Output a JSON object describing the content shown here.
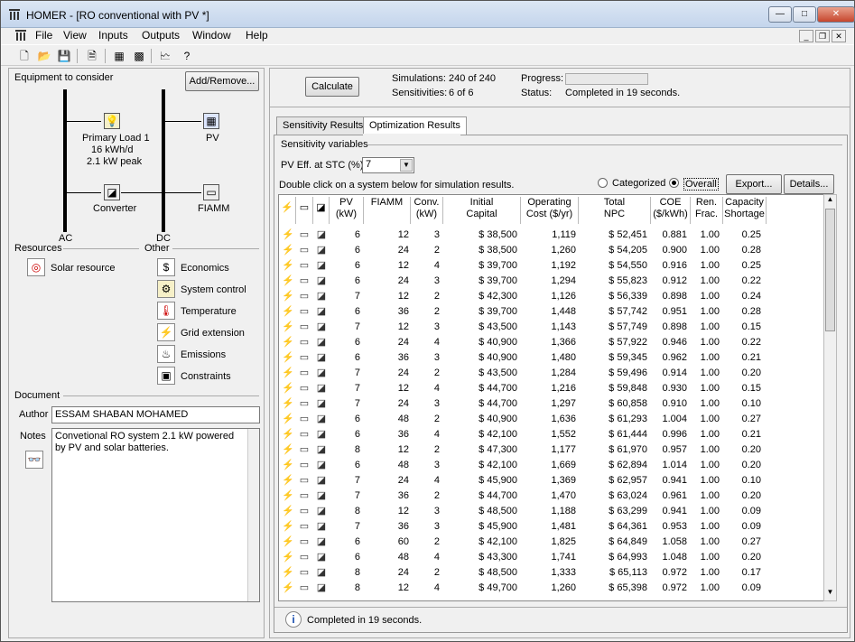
{
  "window": {
    "title": "HOMER - [RO conventional with PV *]"
  },
  "menu": [
    "File",
    "View",
    "Inputs",
    "Outputs",
    "Window",
    "Help"
  ],
  "left": {
    "equipment_label": "Equipment to consider",
    "add_remove": "Add/Remove...",
    "primary_load": [
      "Primary Load 1",
      "16 kWh/d",
      "2.1 kW peak"
    ],
    "pv": "PV",
    "converter": "Converter",
    "fiamm": "FIAMM",
    "ac": "AC",
    "dc": "DC",
    "resources_label": "Resources",
    "other_label": "Other",
    "solar_resource": "Solar resource",
    "other_items": [
      "Economics",
      "System control",
      "Temperature",
      "Grid extension",
      "Emissions",
      "Constraints"
    ],
    "document_label": "Document",
    "author_label": "Author",
    "author_value": "ESSAM SHABAN MOHAMED",
    "notes_label": "Notes",
    "notes_value": "Convetional RO system 2.1 kW powered by PV and solar batteries."
  },
  "right": {
    "calculate": "Calculate",
    "simulations_label": "Simulations:",
    "simulations_value": "240 of 240",
    "sensitivities_label": "Sensitivities:",
    "sensitivities_value": "6 of 6",
    "progress_label": "Progress:",
    "status_label": "Status:",
    "status_value": "Completed in 19 seconds.",
    "tab_sensitivity": "Sensitivity Results",
    "tab_optimization": "Optimization Results",
    "sensitivity_variables": "Sensitivity variables",
    "pv_eff_label": "PV Eff. at STC (%)",
    "pv_eff_value": "7",
    "double_click_hint": "Double click on a system below for simulation results.",
    "categorized": "Categorized",
    "overall": "Overall",
    "export": "Export...",
    "details": "Details...",
    "headers": [
      [
        "PV",
        "(kW)"
      ],
      [
        "FIAMM",
        ""
      ],
      [
        "Conv.",
        "(kW)"
      ],
      [
        "Initial",
        "Capital"
      ],
      [
        "Operating",
        "Cost ($/yr)"
      ],
      [
        "Total",
        "NPC"
      ],
      [
        "COE",
        "($/kWh)"
      ],
      [
        "Ren.",
        "Frac."
      ],
      [
        "Capacity",
        "Shortage"
      ]
    ],
    "rows": [
      [
        "6",
        "12",
        "3",
        "$ 38,500",
        "1,119",
        "$ 52,451",
        "0.881",
        "1.00",
        "0.25"
      ],
      [
        "6",
        "24",
        "2",
        "$ 38,500",
        "1,260",
        "$ 54,205",
        "0.900",
        "1.00",
        "0.28"
      ],
      [
        "6",
        "12",
        "4",
        "$ 39,700",
        "1,192",
        "$ 54,550",
        "0.916",
        "1.00",
        "0.25"
      ],
      [
        "6",
        "24",
        "3",
        "$ 39,700",
        "1,294",
        "$ 55,823",
        "0.912",
        "1.00",
        "0.22"
      ],
      [
        "7",
        "12",
        "2",
        "$ 42,300",
        "1,126",
        "$ 56,339",
        "0.898",
        "1.00",
        "0.24"
      ],
      [
        "6",
        "36",
        "2",
        "$ 39,700",
        "1,448",
        "$ 57,742",
        "0.951",
        "1.00",
        "0.28"
      ],
      [
        "7",
        "12",
        "3",
        "$ 43,500",
        "1,143",
        "$ 57,749",
        "0.898",
        "1.00",
        "0.15"
      ],
      [
        "6",
        "24",
        "4",
        "$ 40,900",
        "1,366",
        "$ 57,922",
        "0.946",
        "1.00",
        "0.22"
      ],
      [
        "6",
        "36",
        "3",
        "$ 40,900",
        "1,480",
        "$ 59,345",
        "0.962",
        "1.00",
        "0.21"
      ],
      [
        "7",
        "24",
        "2",
        "$ 43,500",
        "1,284",
        "$ 59,496",
        "0.914",
        "1.00",
        "0.20"
      ],
      [
        "7",
        "12",
        "4",
        "$ 44,700",
        "1,216",
        "$ 59,848",
        "0.930",
        "1.00",
        "0.15"
      ],
      [
        "7",
        "24",
        "3",
        "$ 44,700",
        "1,297",
        "$ 60,858",
        "0.910",
        "1.00",
        "0.10"
      ],
      [
        "6",
        "48",
        "2",
        "$ 40,900",
        "1,636",
        "$ 61,293",
        "1.004",
        "1.00",
        "0.27"
      ],
      [
        "6",
        "36",
        "4",
        "$ 42,100",
        "1,552",
        "$ 61,444",
        "0.996",
        "1.00",
        "0.21"
      ],
      [
        "8",
        "12",
        "2",
        "$ 47,300",
        "1,177",
        "$ 61,970",
        "0.957",
        "1.00",
        "0.20"
      ],
      [
        "6",
        "48",
        "3",
        "$ 42,100",
        "1,669",
        "$ 62,894",
        "1.014",
        "1.00",
        "0.20"
      ],
      [
        "7",
        "24",
        "4",
        "$ 45,900",
        "1,369",
        "$ 62,957",
        "0.941",
        "1.00",
        "0.10"
      ],
      [
        "7",
        "36",
        "2",
        "$ 44,700",
        "1,470",
        "$ 63,024",
        "0.961",
        "1.00",
        "0.20"
      ],
      [
        "8",
        "12",
        "3",
        "$ 48,500",
        "1,188",
        "$ 63,299",
        "0.941",
        "1.00",
        "0.09"
      ],
      [
        "7",
        "36",
        "3",
        "$ 45,900",
        "1,481",
        "$ 64,361",
        "0.953",
        "1.00",
        "0.09"
      ],
      [
        "6",
        "60",
        "2",
        "$ 42,100",
        "1,825",
        "$ 64,849",
        "1.058",
        "1.00",
        "0.27"
      ],
      [
        "6",
        "48",
        "4",
        "$ 43,300",
        "1,741",
        "$ 64,993",
        "1.048",
        "1.00",
        "0.20"
      ],
      [
        "8",
        "24",
        "2",
        "$ 48,500",
        "1,333",
        "$ 65,113",
        "0.972",
        "1.00",
        "0.17"
      ],
      [
        "8",
        "12",
        "4",
        "$ 49,700",
        "1,260",
        "$ 65,398",
        "0.972",
        "1.00",
        "0.09"
      ]
    ],
    "bottom_status": "Completed in 19 seconds."
  }
}
